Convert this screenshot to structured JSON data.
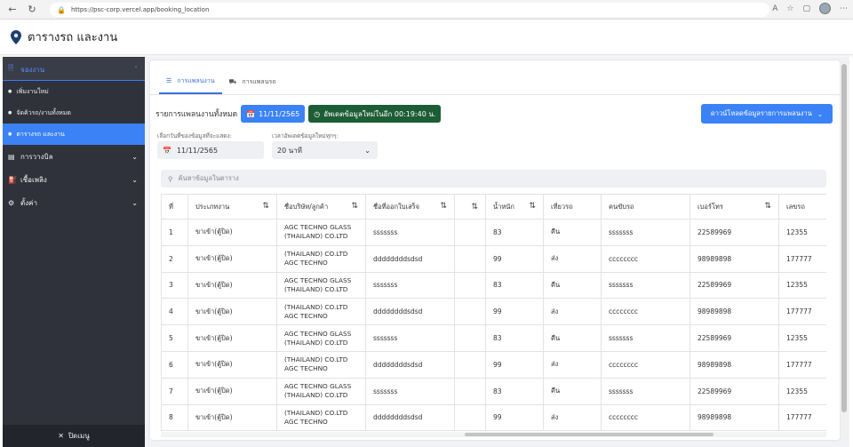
{
  "browser": {
    "url": "https://psc-corp.vercel.app/booking_location"
  },
  "header": {
    "title": "ตารางรถ และงาน"
  },
  "sidebar": {
    "sections": [
      {
        "label": "จองงาน",
        "icon": "document-icon",
        "active": true
      },
      {
        "label": "การวางบิล",
        "icon": "receipt-icon",
        "active": false
      },
      {
        "label": "เชื้อเพลิง",
        "icon": "fuel-icon",
        "active": false
      },
      {
        "label": "ตั้งค่า",
        "icon": "gear-icon",
        "active": false
      }
    ],
    "sub_items": [
      {
        "label": "เพิ่มงานใหม่"
      },
      {
        "label": "จัดคิวรถ/งานทั้งหมด"
      },
      {
        "label": "ตารางรถ และงาน"
      }
    ],
    "footer_label": "ปิดเมนู"
  },
  "tabs": [
    {
      "label": "การแพลนงาน",
      "icon": "list-icon"
    },
    {
      "label": "การแพลนรถ",
      "icon": "truck-icon"
    }
  ],
  "summary": {
    "label": "รายการแพลนงานทั้งหมด",
    "date": "11/11/2565",
    "timer": "อัพเดตข้อมูลใหม่ในอีก 00:19:40 น."
  },
  "download_button": "ดาวน์โหลดข้อมูลรายการแพลนงาน",
  "filters": {
    "date_label": "เลือกวันที่ของข้อมูลที่จะแสดง:",
    "date_value": "11/11/2565",
    "interval_label": "เวลาอัพเดตข้อมูลใหม่ทุกๆ:",
    "interval_value": "20 นาที"
  },
  "search": {
    "placeholder": "ค้นหาข้อมูลในตาราง"
  },
  "table": {
    "columns": [
      "ที่",
      "ประเภทงาน",
      "ชื่อบริษัท/ลูกค้า",
      "ชื่อที่ออกใบเสร็จ",
      "",
      "น้ำหนัก",
      "เที่ยวรถ",
      "คนขับรถ",
      "เบอร์โทร",
      "เลขรถ"
    ],
    "rows": [
      [
        "1",
        "ขาเข้า(ตู้ปิด)",
        "AGC TECHNO GLASS (THAILAND) CO.LTD",
        "sssssss",
        "",
        "83",
        "คืน",
        "sssssss",
        "22589969",
        "12355"
      ],
      [
        "2",
        "ขาเข้า(ตู้ปิด)",
        "(THAILAND) CO.LTD AGC TECHNO",
        "ddddddddsdsd",
        "",
        "99",
        "ส่ง",
        "cccccccc",
        "98989898",
        "177777"
      ],
      [
        "3",
        "ขาเข้า(ตู้ปิด)",
        "AGC TECHNO GLASS (THAILAND) CO.LTD",
        "sssssss",
        "",
        "83",
        "คืน",
        "sssssss",
        "22589969",
        "12355"
      ],
      [
        "4",
        "ขาเข้า(ตู้ปิด)",
        "(THAILAND) CO.LTD AGC TECHNO",
        "ddddddddsdsd",
        "",
        "99",
        "ส่ง",
        "cccccccc",
        "98989898",
        "177777"
      ],
      [
        "5",
        "ขาเข้า(ตู้ปิด)",
        "AGC TECHNO GLASS (THAILAND) CO.LTD",
        "sssssss",
        "",
        "83",
        "คืน",
        "sssssss",
        "22589969",
        "12355"
      ],
      [
        "6",
        "ขาเข้า(ตู้ปิด)",
        "(THAILAND) CO.LTD AGC TECHNO",
        "ddddddddsdsd",
        "",
        "99",
        "ส่ง",
        "cccccccc",
        "98989898",
        "177777"
      ],
      [
        "7",
        "ขาเข้า(ตู้ปิด)",
        "AGC TECHNO GLASS (THAILAND) CO.LTD",
        "sssssss",
        "",
        "83",
        "คืน",
        "sssssss",
        "22589969",
        "12355"
      ],
      [
        "8",
        "ขาเข้า(ตู้ปิด)",
        "(THAILAND) CO.LTD AGC TECHNO",
        "ddddddddsdsd",
        "",
        "99",
        "ส่ง",
        "cccccccc",
        "98989898",
        "177777"
      ]
    ]
  },
  "colors": {
    "primary": "#3b82f6",
    "timer_bg": "#1d5d35",
    "sidebar_bg": "#2f323a"
  }
}
